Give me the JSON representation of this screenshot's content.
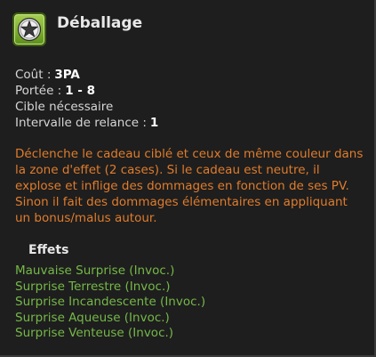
{
  "spell": {
    "name": "Déballage",
    "icon": "star-badge-icon",
    "accent_color": "#7fb12e"
  },
  "stats": [
    {
      "label": "Coût :",
      "value": "3PA"
    },
    {
      "label": "Portée :",
      "value": "1 - 8"
    },
    {
      "label": "Cible nécessaire",
      "value": ""
    },
    {
      "label": "Intervalle de relance :",
      "value": "1"
    }
  ],
  "description": "Déclenche le cadeau ciblé et ceux de même couleur dans la zone d'effet (2 cases). Si le cadeau est neutre, il explose et inflige des dommages en fonction de ses PV. Sinon il fait des dommages élémentaires en appliquant un bonus/malus autour.",
  "effects": {
    "heading": "Effets",
    "items": [
      "Mauvaise Surprise (Invoc.)",
      "Surprise Terrestre (Invoc.)",
      "Surprise Incandescente (Invoc.)",
      "Surprise Aqueuse (Invoc.)",
      "Surprise Venteuse (Invoc.)"
    ]
  },
  "colors": {
    "description": "#e07c2c",
    "effect_link": "#75b848",
    "background": "#1e1e1e"
  }
}
